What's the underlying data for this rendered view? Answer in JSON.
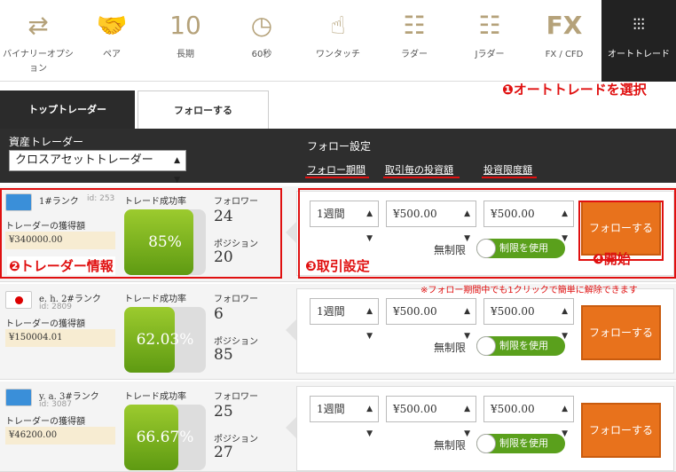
{
  "nav": [
    {
      "label": "バイナリーオプション",
      "icon": "binary-option-icon",
      "glyph": "⇄"
    },
    {
      "label": "ペア",
      "icon": "handshake-icon",
      "glyph": "🤝"
    },
    {
      "label": "長期",
      "icon": "calendar-icon",
      "glyph": "10"
    },
    {
      "label": "60秒",
      "icon": "clock-icon",
      "glyph": "◷"
    },
    {
      "label": "ワンタッチ",
      "icon": "touch-icon",
      "glyph": "☝"
    },
    {
      "label": "ラダー",
      "icon": "ladder-icon",
      "glyph": "☷"
    },
    {
      "label": "Jラダー",
      "icon": "jladder-icon",
      "glyph": "☷"
    },
    {
      "label": "FX / CFD",
      "icon": "fx-icon",
      "glyph": "FX"
    },
    {
      "label": "オートトレード",
      "icon": "sliders-icon",
      "glyph": "⫶⫶⫶"
    }
  ],
  "annotations": {
    "auto_num": "❶",
    "auto": "オートトレードを選択",
    "trader_num": "❷",
    "trader": "トレーダー情報",
    "setting_num": "❸",
    "setting": "取引設定",
    "start_num": "❹",
    "start": "開始",
    "note": "※フォロー期間中でも1クリックで簡単に解除できます"
  },
  "tabs": {
    "top": "トップトレーダー",
    "follow": "フォローする"
  },
  "filter": {
    "label": "資産トレーダー",
    "select": "クロスアセットトレーダー",
    "follow_settings": "フォロー設定",
    "period": "フォロー期間",
    "per_trade": "取引毎の投資額",
    "limit": "投資限度額"
  },
  "labels": {
    "earn": "トレーダーの獲得額",
    "rate": "トレード成功率",
    "followers": "フォロワー",
    "positions": "ポジション",
    "unlimited": "無制限",
    "toggle": "制限を使用",
    "follow_btn": "フォローする"
  },
  "traders": [
    {
      "rank": "1#ランク",
      "id": "id: 253",
      "earn": "¥340000.00",
      "rate_text": "85%",
      "rate": 85,
      "followers": "24",
      "positions": "20",
      "period": "1週間",
      "per_trade": "¥500.00",
      "limit": "¥500.00",
      "flag": "un"
    },
    {
      "rank": "e. h.  2#ランク",
      "id": "id: 2809",
      "earn": "¥150004.01",
      "rate_text": "62.03%",
      "rate": 62.03,
      "followers": "6",
      "positions": "85",
      "period": "1週間",
      "per_trade": "¥500.00",
      "limit": "¥500.00",
      "flag": "jp"
    },
    {
      "rank": "y. a.  3#ランク",
      "id": "id: 3087",
      "earn": "¥46200.00",
      "rate_text": "66.67%",
      "rate": 66.67,
      "followers": "25",
      "positions": "27",
      "period": "1週間",
      "per_trade": "¥500.00",
      "limit": "¥500.00",
      "flag": "un"
    }
  ],
  "colors": {
    "accent": "#e8721c",
    "annotation": "#e01010",
    "success": "#5aa01c"
  }
}
